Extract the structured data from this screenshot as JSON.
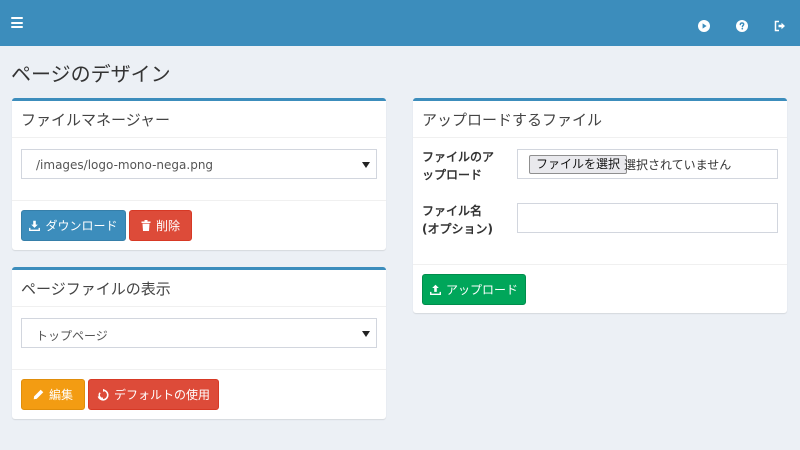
{
  "colors": {
    "header": "#3c8dbc",
    "primary": "#3c8dbc",
    "danger": "#dd4b39",
    "warning": "#f39c12",
    "success": "#00a65a"
  },
  "header": {
    "menu_icon": "hamburger-icon",
    "right_icons": [
      "play-circle-icon",
      "question-circle-icon",
      "sign-out-icon"
    ]
  },
  "page": {
    "title": "ページのデザイン"
  },
  "file_manager": {
    "title": "ファイルマネージャー",
    "selected_file": "/images/logo-mono-nega.png",
    "download_label": "ダウンロード",
    "delete_label": "削除"
  },
  "page_file_view": {
    "title": "ページファイルの表示",
    "selected_page": "トップページ",
    "edit_label": "編集",
    "use_default_label": "デフォルトの使用"
  },
  "upload": {
    "title": "アップロードするファイル",
    "file_label_line1": "ファイルのア",
    "file_label_line2": "ップロード",
    "choose_file_label": "ファイルを選択",
    "no_file_text": "選択されていません",
    "filename_label_line1": "ファイル名",
    "filename_label_line2": "(オプション)",
    "filename_value": "",
    "upload_label": "アップロード"
  }
}
